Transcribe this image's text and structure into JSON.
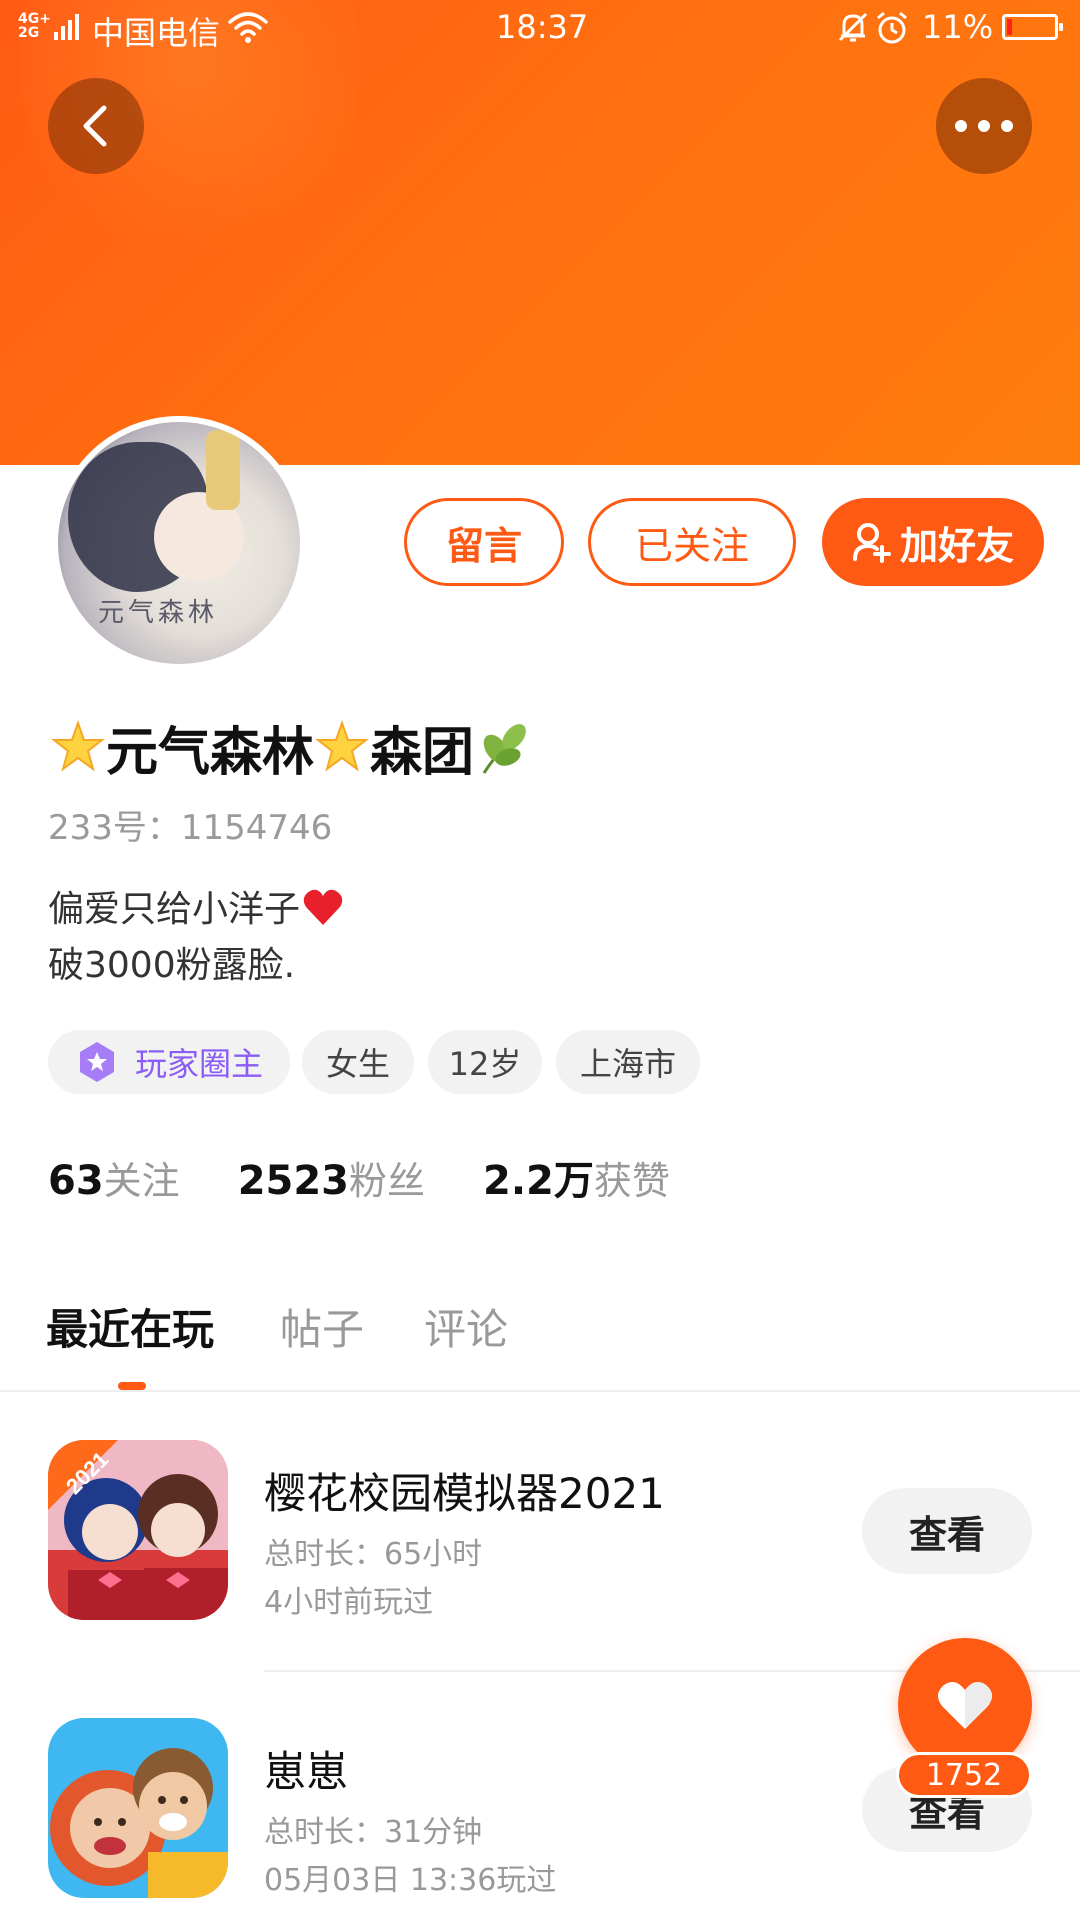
{
  "status_bar": {
    "signal": "4G+\n2G",
    "carrier": "中国电信",
    "time": "18:37",
    "battery": "11%",
    "battery_level": 0.11
  },
  "profile": {
    "name": "元气森林",
    "team": "森团",
    "uid": "233号：1154746",
    "bio_line1": "偏爱只给小洋子",
    "bio_line2": "破3000粉露脸.",
    "avatar_caption": "元气森林"
  },
  "actions": {
    "message": "留言",
    "following": "已关注",
    "add_friend": "加好友"
  },
  "tags": {
    "host": "玩家圈主",
    "gender": "女生",
    "age": "12岁",
    "city": "上海市"
  },
  "stats": {
    "following_num": "63",
    "following_label": "关注",
    "fans_num": "2523",
    "fans_label": "粉丝",
    "likes_num": "2.2万",
    "likes_label": "获赞"
  },
  "tabs": [
    "最近在玩",
    "帖子",
    "评论"
  ],
  "games": [
    {
      "title": "樱花校园模拟器2021",
      "duration": "总时长：65小时",
      "last_played": "4小时前玩过",
      "action": "查看",
      "badge": "2021"
    },
    {
      "title": "崽崽",
      "duration": "总时长：31分钟",
      "last_played": "05月03日 13:36玩过",
      "action": "查看"
    }
  ],
  "like": {
    "count": "1752"
  },
  "colors": {
    "accent": "#ff5a14",
    "host_tag": "#8b5cf6"
  },
  "icons": [
    "back-arrow-icon",
    "more-dots-icon",
    "add-user-icon",
    "star-emoji-icon",
    "leaf-emoji-icon",
    "heart-emoji-icon",
    "star-badge-icon",
    "heart-like-icon"
  ]
}
